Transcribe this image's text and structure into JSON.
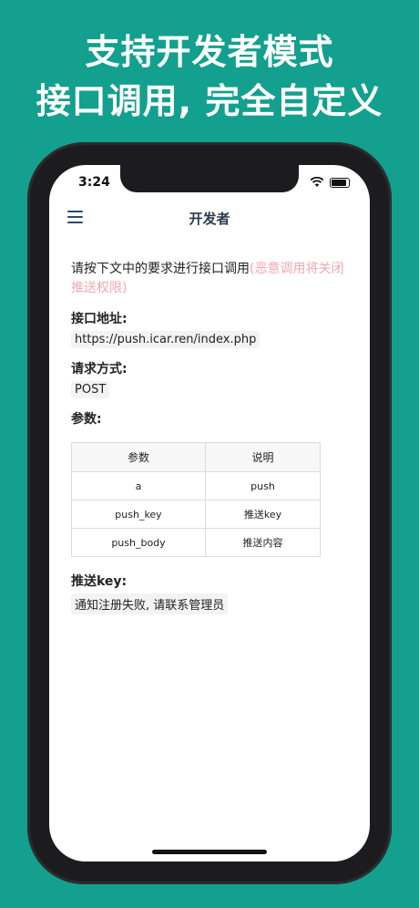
{
  "headline": {
    "line1": "支持开发者模式",
    "line2": "接口调用, 完全自定义"
  },
  "status_bar": {
    "time": "3:24",
    "icons": [
      "wifi-icon",
      "battery-icon"
    ]
  },
  "navbar": {
    "title": "开发者",
    "menu_icon": "hamburger-menu-icon"
  },
  "content": {
    "intro_text": "请按下文中的要求进行接口调用",
    "intro_warning": "(恶意调用将关闭推送权限)",
    "endpoint_label": "接口地址:",
    "endpoint_value": "https://push.icar.ren/index.php",
    "method_label": "请求方式:",
    "method_value": "POST",
    "params_label": "参数:",
    "params_table": {
      "headers": [
        "参数",
        "说明"
      ],
      "rows": [
        [
          "a",
          "push"
        ],
        [
          "push_key",
          "推送key"
        ],
        [
          "push_body",
          "推送内容"
        ]
      ]
    },
    "push_key_label": "推送key:",
    "push_key_value": "通知注册失败, 请联系管理员"
  },
  "colors": {
    "background": "#13a08e",
    "warning_text": "#f3a7b2",
    "nav_title": "#2b3a4a"
  }
}
